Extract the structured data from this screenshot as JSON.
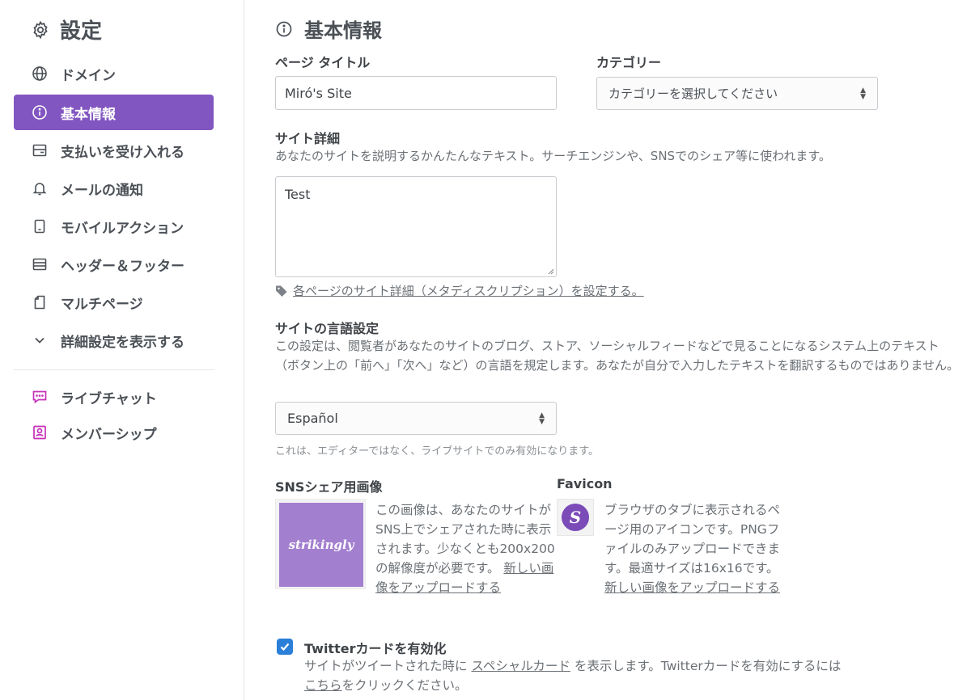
{
  "sidebar": {
    "title": "設定",
    "items": [
      {
        "label": "ドメイン",
        "icon": "globe-icon"
      },
      {
        "label": "基本情報",
        "icon": "info-icon",
        "active": true
      },
      {
        "label": "支払いを受け入れる",
        "icon": "wallet-icon"
      },
      {
        "label": "メールの通知",
        "icon": "bell-icon"
      },
      {
        "label": "モバイルアクション",
        "icon": "mobile-icon"
      },
      {
        "label": "ヘッダー＆フッター",
        "icon": "layout-icon"
      },
      {
        "label": "マルチページ",
        "icon": "page-icon"
      },
      {
        "label": "詳細設定を表示する",
        "icon": "chevron-down-icon"
      }
    ],
    "extras": [
      {
        "label": "ライブチャット",
        "icon": "chat-icon"
      },
      {
        "label": "メンバーシップ",
        "icon": "member-icon"
      }
    ],
    "active_color": "#8256c1",
    "extra_icon_color": "#c62fb8"
  },
  "main": {
    "title": "基本情報",
    "page_title": {
      "label": "ページ タイトル",
      "value": "Miró's Site"
    },
    "category": {
      "label": "カテゴリー",
      "value": "カテゴリーを選択してください"
    },
    "site_detail": {
      "label": "サイト詳細",
      "desc": "あなたのサイトを説明するかんたんなテキスト。サーチエンジンや、SNSでのシェア等に使われます。",
      "value": "Test",
      "meta_link": "各ページのサイト詳細（メタディスクリプション）を設定する。"
    },
    "language": {
      "label": "サイトの言語設定",
      "desc": "この設定は、閲覧者があなたのサイトのブログ、ストア、ソーシャルフィードなどで見ることになるシステム上のテキスト（ボタン上の「前へ」「次へ」など）の言語を規定します。あなたが自分で入力したテキストを翻訳するものではありません。",
      "value": "Español",
      "note": "これは、エディターではなく、ライブサイトでのみ有効になります。"
    },
    "sns_image": {
      "label": "SNSシェア用画像",
      "logo_text": "strikingly",
      "desc": "この画像は、あなたのサイトがSNS上でシェアされた時に表示されます。少なくとも200x200の解像度が必要です。",
      "link": "新しい画像をアップロードする"
    },
    "favicon": {
      "label": "Favicon",
      "letter": "S",
      "desc": "ブラウザのタブに表示されるページ用のアイコンです。PNGファイルのみアップロードできます。最適サイズは16x16です。",
      "link": "新しい画像をアップロードする"
    },
    "twitter": {
      "label": "Twitterカードを有効化",
      "checked": true,
      "desc_pre": "サイトがツイートされた時に",
      "desc_link": "スペシャルカード",
      "desc_mid": "を表示します。Twitterカードを有効にするには",
      "desc_link2": "こちら",
      "desc_post": "をクリックください。"
    }
  }
}
